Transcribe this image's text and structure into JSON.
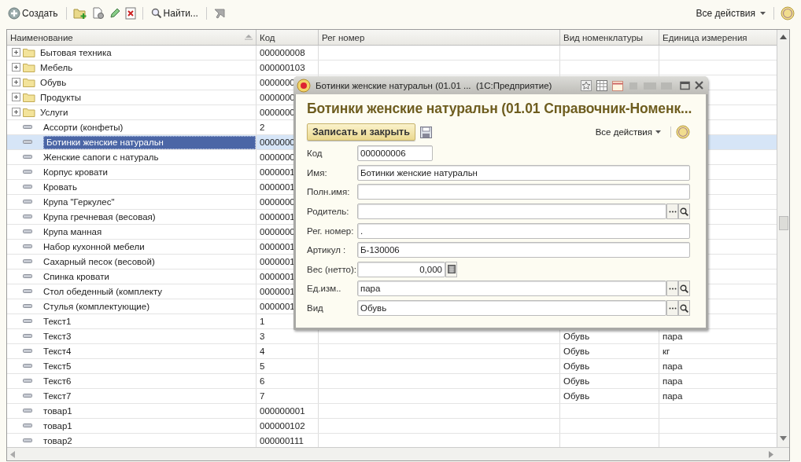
{
  "toolbar": {
    "create_label": "Создать",
    "find_label": "Найти...",
    "all_actions": "Все действия"
  },
  "table": {
    "columns": [
      "Наименование",
      "Код",
      "Рег номер",
      "Вид номенклатуры",
      "Единица измерения"
    ],
    "rows": [
      {
        "kind": "group",
        "name": "Бытовая техника",
        "code": "000000008",
        "selected": false
      },
      {
        "kind": "group",
        "name": "Мебель",
        "code": "000000103",
        "selected": false
      },
      {
        "kind": "group",
        "name": "Обувь",
        "code": "0000000",
        "selected": false
      },
      {
        "kind": "group",
        "name": "Продукты",
        "code": "0000000",
        "selected": false
      },
      {
        "kind": "group",
        "name": "Услуги",
        "code": "0000000",
        "selected": false
      },
      {
        "kind": "item",
        "name": "Ассорти (конфеты)",
        "code": "2",
        "selected": false
      },
      {
        "kind": "item",
        "name": "Ботинки женские натуральн",
        "code": "0000000",
        "selected": true
      },
      {
        "kind": "item",
        "name": "Женские сапоги с натураль",
        "code": "0000000",
        "selected": false
      },
      {
        "kind": "item",
        "name": "Корпус кровати",
        "code": "0000001",
        "selected": false
      },
      {
        "kind": "item",
        "name": "Кровать",
        "code": "0000001",
        "selected": false
      },
      {
        "kind": "item",
        "name": "Крупа \"Геркулес\"",
        "code": "0000000",
        "selected": false
      },
      {
        "kind": "item",
        "name": "Крупа гречневая (весовая)",
        "code": "0000001",
        "selected": false
      },
      {
        "kind": "item",
        "name": "Крупа манная",
        "code": "0000000",
        "selected": false
      },
      {
        "kind": "item",
        "name": "Набор кухонной мебели",
        "code": "0000001",
        "selected": false
      },
      {
        "kind": "item",
        "name": "Сахарный песок (весовой)",
        "code": "0000001",
        "selected": false
      },
      {
        "kind": "item",
        "name": "Спинка кровати",
        "code": "0000001",
        "selected": false
      },
      {
        "kind": "item",
        "name": "Стол обеденный (комплекту",
        "code": "0000001",
        "selected": false
      },
      {
        "kind": "item",
        "name": "Стулья (комплектующие)",
        "code": "0000001",
        "selected": false
      },
      {
        "kind": "item",
        "name": "Текст1",
        "code": "1",
        "selected": false
      },
      {
        "kind": "item",
        "name": "Текст3",
        "code": "3",
        "type": "Обувь",
        "unit": "пара",
        "selected": false
      },
      {
        "kind": "item",
        "name": "Текст4",
        "code": "4",
        "type": "Обувь",
        "unit": "кг",
        "selected": false
      },
      {
        "kind": "item",
        "name": "Текст5",
        "code": "5",
        "type": "Обувь",
        "unit": "пара",
        "selected": false
      },
      {
        "kind": "item",
        "name": "Текст6",
        "code": "6",
        "type": "Обувь",
        "unit": "пара",
        "selected": false
      },
      {
        "kind": "item",
        "name": "Текст7",
        "code": "7",
        "type": "Обувь",
        "unit": "пара",
        "selected": false
      },
      {
        "kind": "item",
        "name": "товар1",
        "code": "000000001",
        "selected": false
      },
      {
        "kind": "item",
        "name": "товар1",
        "code": "000000102",
        "selected": false
      },
      {
        "kind": "item",
        "name": "товар2",
        "code": "000000111",
        "selected": false
      }
    ]
  },
  "dialog": {
    "title": "Ботинки женские натуральн (01.01 ...  (1С:Предприятие)",
    "heading": "Ботинки женские натуральн (01.01 Справочник-Номенк...",
    "save_close": "Записать и закрыть",
    "all_actions": "Все действия",
    "fields": [
      {
        "label": "Код",
        "value": "000000006",
        "kind": "code"
      },
      {
        "label": "Имя:",
        "value": "Ботинки женские натуральн",
        "kind": "text"
      },
      {
        "label": "Полн.имя:",
        "kind": "text"
      },
      {
        "label": "Родитель:",
        "kind": "lookup"
      },
      {
        "label": "Рег. номер:",
        "value": ".",
        "kind": "text"
      },
      {
        "label": "Артикул :",
        "value": "Б-130006",
        "kind": "text"
      },
      {
        "label": "Вес (нетто):",
        "value": "0,000",
        "kind": "number"
      },
      {
        "label": "Ед.изм..",
        "value": "пара",
        "kind": "lookup"
      },
      {
        "label": "Вид",
        "value": "Обувь",
        "kind": "lookup"
      }
    ]
  }
}
